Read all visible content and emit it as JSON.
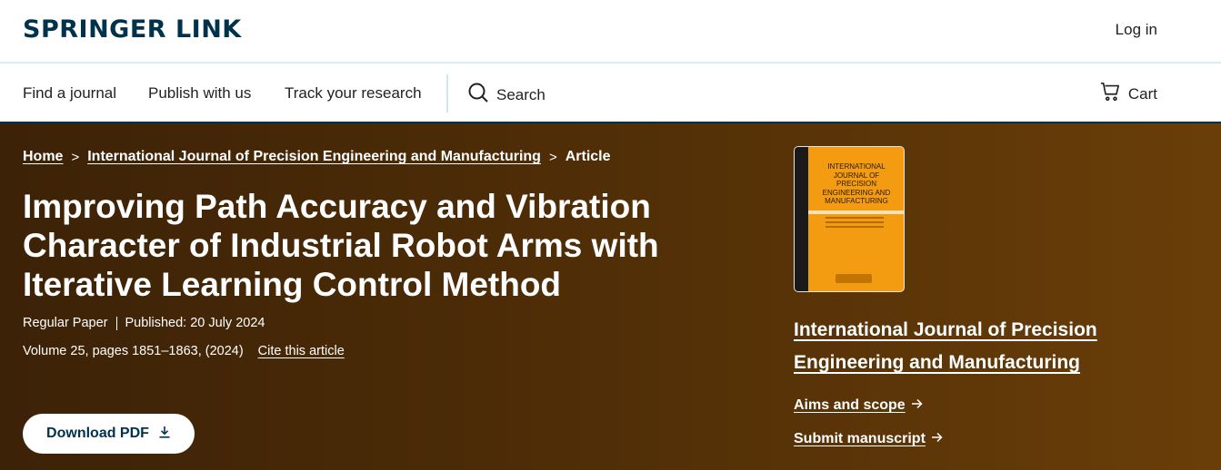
{
  "header": {
    "logo": "SPRINGER LINK",
    "login_label": "Log in"
  },
  "nav": {
    "items": [
      {
        "label": "Find a journal"
      },
      {
        "label": "Publish with us"
      },
      {
        "label": "Track your research"
      }
    ],
    "search_label": "Search",
    "cart_label": "Cart"
  },
  "breadcrumb": {
    "home": "Home",
    "journal": "International Journal of Precision Engineering and Manufacturing",
    "current": "Article",
    "separator": ">"
  },
  "article": {
    "title": "Improving Path Accuracy and Vibration Character of Industrial Robot Arms with Iterative Learning Control Method",
    "type": "Regular Paper",
    "published": "Published: 20 July 2024",
    "volume": "Volume 25, pages 1851–1863, (2024)",
    "cite_label": "Cite this article",
    "download_label": "Download PDF"
  },
  "journal": {
    "cover_text": "International Journal of Precision Engineering and Manufacturing",
    "title": "International Journal of Precision Engineering and Manufacturing",
    "aims_label": "Aims and scope",
    "submit_label": "Submit manuscript"
  },
  "colors": {
    "brand": "#01324b",
    "hero_start": "#3c2207",
    "hero_end": "#6a3e08",
    "cover": "#f39c12"
  }
}
